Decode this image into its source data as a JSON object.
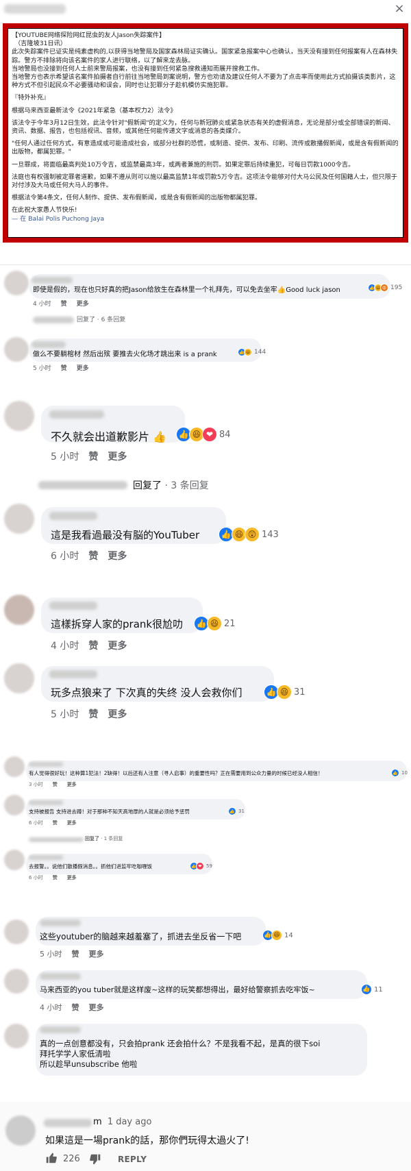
{
  "post": {
    "lines": [
      "【YOUTUBE网络探险网红昆虫的友人Jason失踪案件】",
      "（吉隆坡31日讯）",
      "此次失踪案件已证实是纯素虚构的,以获得当地警局及国家森林局证实确认。国家紧急报案中心也确认，当天没有接到任何报案有人在森林失踪。警方不排除将向该名案件的家人进行联络，以了解来龙去脉。",
      "当地警局也没接到任何人士前来警局报案，也没有接到任何紧急搜救通知而展开搜救工作。",
      "当地警方也表示希望该名案件拍摄者自行前往当地警局到案说明，警方也劝请及建议任何人不要为了点击率而使用此方式拍摄该类影片，这种方式不但引起民众不必要骚动和误会，同时也让犯罪分子趁机模仿实施犯罪。",
      "『特外补充』",
      "根据马来西亚最新法令《2021年紧急（基本权力2）法令》",
      "该法令于今年3月12日生效，此法令针对\"假新闻\"的定义为，任何与新冠肺炎或紧急状态有关的虚假消息，无论是部分或全部错误的新闻、资讯、数据、报告，也包括视讯、音频，或其他任何能传递文字或消息的各类媒介。",
      "\"任何人通过任何方式，有意造成或可能造成社会，或部分社群的恐慌，或制造、提供、发布、印刷、流传或散播假新闻，或是含有假新闻的出版物，都属犯罪。\"",
      "一旦罪成，将面临最高判处10万令吉，或监禁最高3年，或两者兼施的刑罚。如果定罪后持续重犯，可每日罚款1000令吉。",
      "法庭也有权强制被定罪者道歉，如果不遵从则可以施以最高监禁1年或罚款5万令吉。这项法令能够对付大马公民及任何国籍人士，但只限于对付涉及大马或任何大马人的事件。",
      "根据法令第4条文，任何人制作、提供、发布假新闻，或是含有假新闻的出版物都属犯罪。",
      "在此祝大家愚人节快乐!"
    ],
    "location": "— 在 Balai Polis Puchong Jaya"
  },
  "actions": {
    "like": "赞",
    "more": "更多",
    "replied": "回复了",
    "reply_btn": "REPLY"
  },
  "comments": [
    {
      "text": "即使是假的，现在也只好真的把Jason给放生在森林里一个礼拜先，可以免去坐牢👍Good luck jason",
      "time": "4 小时",
      "count": "195"
    },
    {
      "replies": "6 条回复"
    },
    {
      "text": "做么不要躺棺材 然后出殡 要推去火化场才跳出来 is a prank",
      "time": "5 小时",
      "count": "144"
    },
    {
      "text": "不久就会出道歉影片 👍",
      "time": "5 小时",
      "count": "84"
    },
    {
      "replies": "3 条回复"
    },
    {
      "text": "這是我看過最没有脳的YouTuber",
      "time": "6 小时",
      "count": "143"
    },
    {
      "text": "這樣拆穿人家的prank很尬叻",
      "time": "4 小时",
      "count": "21"
    },
    {
      "text": "玩多点狼来了 下次真的失终 没人会救你们",
      "time": "5 小时",
      "count": "31"
    },
    {
      "text": "有人觉得很好玩！这种算1犯法！2缺得！以后还有人注意（寻人启事）的重要性吗？正在需要用到公众力量的时候已经没人相信！",
      "time": "3 小时",
      "count": "10"
    },
    {
      "text": "支持被报告 支持进去蹲！对于那种不知天高地厚的人就是必须给予惩罚",
      "time": "6 小时",
      "count": "31"
    },
    {
      "replies": "1 条回复"
    },
    {
      "text": "去报警。。说他们散播假消息。。抓他们进监牢吃咖喱饭",
      "time": "6 小时",
      "count": "59"
    },
    {
      "text": "这些youtuber的脑越来越羞塞了，抓进去坐反省一下吧",
      "time": "5 小时",
      "count": "14"
    },
    {
      "text": "马来西亚的you tuber就是这样废~这样的玩笑都想得出，最好给警察抓去吃牢饭~",
      "time": "4 小时",
      "count": "11"
    },
    {
      "text_lines": [
        "真的一点创意都没有，只会拍prank 还会拍什么？不是我看不起，是真的很下soi",
        "拜托学学人家低清啦",
        "所以趁早unsubscribe 他啦"
      ]
    }
  ],
  "youtube": {
    "name_suffix": "m",
    "time": "1 day ago",
    "text": "如果這是一場prank的話，那你們玩得太過火了!",
    "likes": "226"
  },
  "icons": {
    "close": "close-icon",
    "like": "thumbs-up-icon",
    "dislike": "thumbs-down-icon"
  }
}
